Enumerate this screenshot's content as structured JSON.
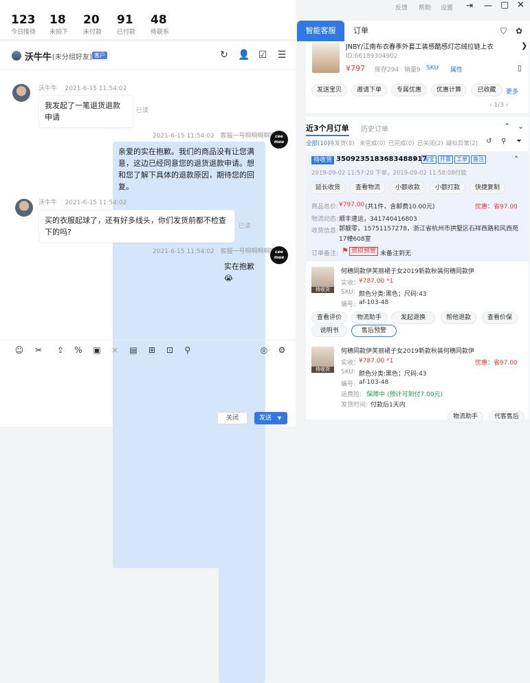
{
  "stats": [
    {
      "num": "123",
      "label": "今日接待"
    },
    {
      "num": "18",
      "label": "未拍下"
    },
    {
      "num": "20",
      "label": "未付款"
    },
    {
      "num": "91",
      "label": "已付款"
    },
    {
      "num": "48",
      "label": "待联系"
    }
  ],
  "chat": {
    "name": "沃牛牛",
    "group": "[未分组好友]",
    "badge": "客户",
    "messages": [
      {
        "sender": "沃牛牛",
        "time": "2021-6-15 11:54:02",
        "text": "我发起了一笔退货退款申请",
        "read": "已读"
      },
      {
        "time": "2021-6-15 11:54:02",
        "sender": "客服一号啊啊啊啊啊",
        "text": "亲爱的实在抱歉。我们的商品没有让您满意，这边已经同意您的退货退款申请。想和您了解下具体的退款原因，期待您的回复。"
      },
      {
        "sender": "沃牛牛",
        "time": "2021-6-15 11:54:02",
        "text": "买的衣服起球了，还有好多线头，你们发货前都不检查下的吗?",
        "read": "已读"
      },
      {
        "time": "2021-6-15 11:54:02",
        "sender": "客服一号啊啊啊啊啊",
        "text": "实在抱歉😭"
      }
    ],
    "close_label": "关闭",
    "send_label": "发送"
  },
  "top_links": [
    "反馈",
    "帮助",
    "设置"
  ],
  "tabs": {
    "active": "智能客服",
    "other": "订单"
  },
  "product": {
    "title": "JNBY/江南布衣春季外套工装感酷感灯芯绒拉链上衣",
    "id": "ID:66189304902",
    "price": "¥797",
    "stock": "库存294",
    "sales": "销量9",
    "sku": "SKU",
    "attr": "属性",
    "pager": "1/3",
    "more": "更多",
    "actions": [
      "发送宝贝",
      "邀请下单",
      "专属优惠",
      "优惠计算",
      "已收藏"
    ]
  },
  "orders": {
    "tab_active": "近3个月订单",
    "tab_other": "历史订单",
    "filters": [
      "全部(10)",
      "待发货(8)",
      "未完成(0)",
      "已完成(0)",
      "已关闭(2)",
      "疑似异常(2)"
    ],
    "status": "待收货",
    "order_no": "3509235183683488917",
    "tags": [
      "淘宝",
      "开票",
      "工单",
      "备注"
    ],
    "created": "2019-09-02 11:57:20 下单，2019-09-02 11:58:08付款",
    "actions": [
      "延长收货",
      "查看物流",
      "小额收款",
      "小额打款",
      "快捷复制"
    ],
    "total_label": "商品总价:",
    "total": "¥797.00",
    "total_note": "(共1件，含邮费10.00元)",
    "discount": "优惠：省97.00",
    "logistics_label": "物流动态:",
    "logistics": "顺丰速运，341740416803",
    "address_label": "收货信息:",
    "address": "郭靓零，15751157278，浙江省杭州市拱墅区石祥西路和风西苑17幢608室",
    "remark_label": "订单备注:",
    "remark_tag": "资损预警",
    "remark": "未备注到无",
    "item1": {
      "name": "何穗同款伊芙丽裙子女2019新款秋装何穗同款伊",
      "price_label": "实收：",
      "price": "¥787.00 *1",
      "sku_label": "SKU:",
      "sku": "颜色分类:黑色；尺码:43",
      "no_label": "编号:",
      "no": "af-103-48",
      "img_tag": "待收货",
      "actions": [
        "查看评价",
        "物流助手",
        "发起退换",
        "帮他退款",
        "查看价保",
        "说明书",
        "售后预警"
      ]
    },
    "item2": {
      "name": "何穗同款伊芙丽裙子女2019新款秋装何穗同款伊",
      "price_label": "实收：",
      "price": "¥787.00 *1",
      "discount": "优惠：省97.00",
      "sku_label": "SKU:",
      "sku": "颜色分类:黑色；尺码:43",
      "no_label": "编号:",
      "no": "af-103-48",
      "img_tag": "待收货",
      "insurance_label": "运费险:",
      "insurance": "保障中",
      "insurance_note": "(预计可到付7.00元)",
      "ship_label": "发货时间:",
      "ship": "付款后1天内",
      "actions": [
        "物流助手",
        "代客售后"
      ]
    }
  }
}
